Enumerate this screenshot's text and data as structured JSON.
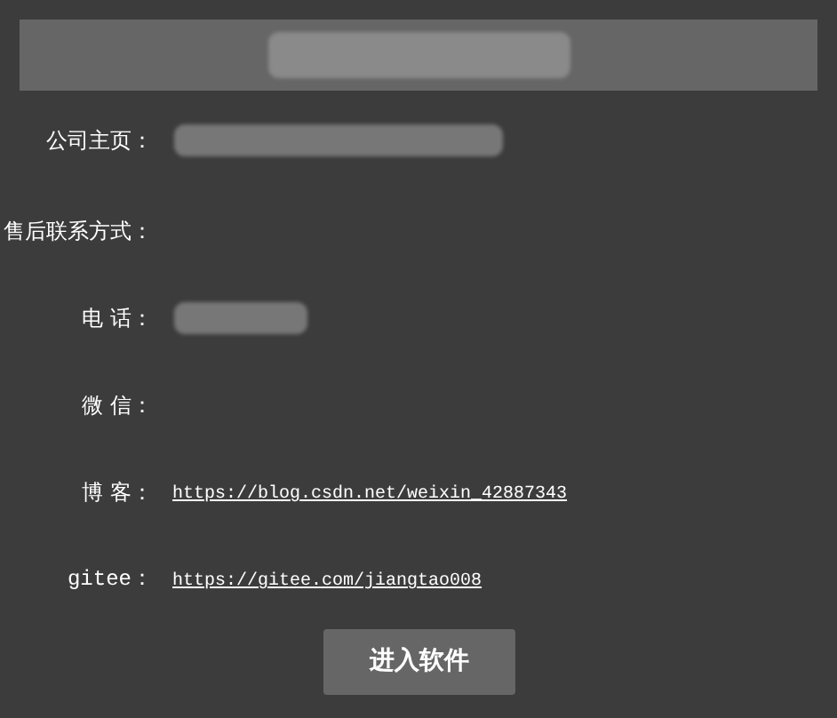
{
  "header": {
    "redacted": true
  },
  "rows": [
    {
      "label": "公司主页：",
      "kind": "redacted"
    },
    {
      "label": "售后联系方式：",
      "kind": "none"
    },
    {
      "label": "电 话：",
      "kind": "redacted"
    },
    {
      "label": "微 信：",
      "kind": "none"
    },
    {
      "label": "博 客：",
      "kind": "link",
      "value": "https://blog.csdn.net/weixin_42887343"
    },
    {
      "label": "gitee：",
      "kind": "link",
      "value": "https://gitee.com/jiangtao008"
    }
  ],
  "button": "进入软件"
}
